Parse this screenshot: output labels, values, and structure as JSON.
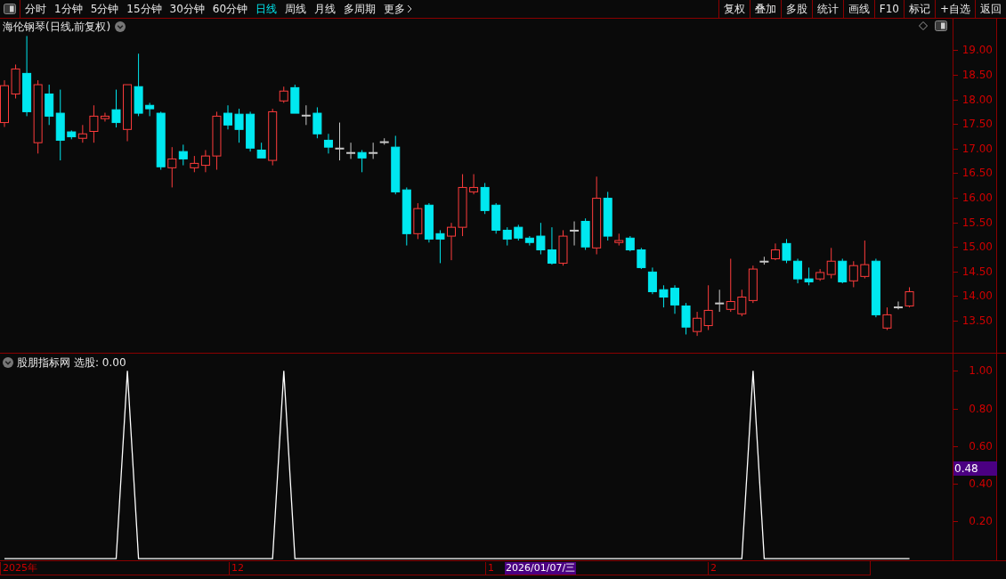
{
  "toolbar": {
    "periods": [
      {
        "label": "分时",
        "selected": false
      },
      {
        "label": "1分钟",
        "selected": false
      },
      {
        "label": "5分钟",
        "selected": false
      },
      {
        "label": "15分钟",
        "selected": false
      },
      {
        "label": "30分钟",
        "selected": false
      },
      {
        "label": "60分钟",
        "selected": false
      },
      {
        "label": "日线",
        "selected": true
      },
      {
        "label": "周线",
        "selected": false
      },
      {
        "label": "月线",
        "selected": false
      },
      {
        "label": "多周期",
        "selected": false
      },
      {
        "label": "更多",
        "selected": false
      }
    ],
    "buttons": [
      "复权",
      "叠加",
      "多股",
      "统计",
      "画线",
      "F10",
      "标记",
      "+自选",
      "返回"
    ]
  },
  "main_chart": {
    "title": "海伦钢琴(日线,前复权)",
    "chart_data": {
      "type": "candlestick",
      "ylim": [
        12.81,
        19.64
      ],
      "yticks": [
        {
          "value": 19,
          "label": "19.00"
        },
        {
          "value": 18.5,
          "label": "18.50"
        },
        {
          "value": 18,
          "label": "18.00"
        },
        {
          "value": 17.5,
          "label": "17.50"
        },
        {
          "value": 17,
          "label": "17.00"
        },
        {
          "value": 16.5,
          "label": "16.50"
        },
        {
          "value": 16,
          "label": "16.00"
        },
        {
          "value": 15.5,
          "label": "15.50"
        },
        {
          "value": 15,
          "label": "15.00"
        },
        {
          "value": 14.5,
          "label": "14.50"
        },
        {
          "value": 14,
          "label": "14.00"
        },
        {
          "value": 13.5,
          "label": "13.50"
        }
      ],
      "ohlc": [
        [
          17.51,
          18.37,
          17.42,
          18.26
        ],
        [
          18.09,
          18.69,
          18.0,
          18.6
        ],
        [
          18.51,
          19.27,
          17.64,
          17.73
        ],
        [
          17.1,
          18.37,
          16.88,
          18.28
        ],
        [
          18.09,
          18.28,
          17.46,
          17.64
        ],
        [
          17.7,
          18.18,
          16.74,
          17.15
        ],
        [
          17.32,
          17.35,
          17.17,
          17.22
        ],
        [
          17.19,
          17.46,
          17.1,
          17.28
        ],
        [
          17.33,
          17.86,
          17.1,
          17.64
        ],
        [
          17.59,
          17.71,
          17.53,
          17.64
        ],
        [
          17.77,
          18.18,
          17.41,
          17.51
        ],
        [
          17.37,
          18.28,
          17.13,
          18.28
        ],
        [
          18.24,
          18.91,
          17.64,
          17.7
        ],
        [
          17.86,
          17.91,
          17.64,
          17.79
        ],
        [
          17.7,
          17.73,
          16.55,
          16.61
        ],
        [
          16.59,
          17.01,
          16.19,
          16.77
        ],
        [
          16.92,
          17.06,
          16.64,
          16.77
        ],
        [
          16.59,
          16.83,
          16.5,
          16.68
        ],
        [
          16.64,
          16.95,
          16.5,
          16.83
        ],
        [
          16.83,
          17.73,
          16.55,
          17.64
        ],
        [
          17.7,
          17.86,
          17.37,
          17.46
        ],
        [
          17.68,
          17.79,
          17.1,
          17.37
        ],
        [
          17.68,
          17.73,
          16.92,
          16.99
        ],
        [
          16.95,
          17.1,
          16.79,
          16.79
        ],
        [
          16.74,
          17.79,
          16.64,
          17.73
        ],
        [
          17.95,
          18.24,
          17.91,
          18.15
        ],
        [
          18.22,
          18.28,
          17.7,
          17.7
        ],
        [
          17.66,
          17.86,
          17.46,
          17.66
        ],
        [
          17.7,
          17.82,
          17.19,
          17.28
        ],
        [
          17.15,
          17.28,
          16.88,
          17.01
        ],
        [
          16.99,
          17.51,
          16.74,
          16.99
        ],
        [
          16.9,
          17.1,
          16.77,
          16.9
        ],
        [
          16.9,
          16.95,
          16.5,
          16.79
        ],
        [
          16.9,
          17.1,
          16.77,
          16.9
        ],
        [
          17.12,
          17.19,
          17.06,
          17.12
        ],
        [
          17.01,
          17.24,
          16.05,
          16.1
        ],
        [
          16.14,
          16.19,
          15.01,
          15.25
        ],
        [
          15.25,
          15.87,
          15.14,
          15.76
        ],
        [
          15.83,
          15.87,
          15.07,
          15.14
        ],
        [
          15.25,
          15.32,
          14.65,
          15.14
        ],
        [
          15.2,
          15.47,
          14.71,
          15.38
        ],
        [
          15.38,
          16.46,
          15.2,
          16.19
        ],
        [
          16.1,
          16.46,
          16.05,
          16.19
        ],
        [
          16.19,
          16.28,
          15.65,
          15.72
        ],
        [
          15.83,
          15.87,
          15.25,
          15.32
        ],
        [
          15.32,
          15.38,
          15.01,
          15.14
        ],
        [
          15.38,
          15.43,
          15.11,
          15.16
        ],
        [
          15.16,
          15.2,
          15.01,
          15.07
        ],
        [
          15.2,
          15.47,
          14.83,
          14.92
        ],
        [
          14.92,
          15.38,
          14.62,
          14.65
        ],
        [
          14.65,
          15.32,
          14.6,
          15.2
        ],
        [
          15.32,
          15.5,
          15.01,
          15.32
        ],
        [
          15.5,
          15.56,
          14.92,
          14.98
        ],
        [
          14.96,
          16.41,
          14.83,
          15.97
        ],
        [
          15.97,
          16.1,
          15.11,
          15.2
        ],
        [
          15.07,
          15.25,
          15.01,
          15.11
        ],
        [
          15.16,
          15.2,
          14.89,
          14.92
        ],
        [
          14.92,
          14.96,
          14.53,
          14.56
        ],
        [
          14.47,
          14.56,
          14.02,
          14.07
        ],
        [
          14.11,
          14.2,
          13.75,
          13.96
        ],
        [
          14.14,
          14.2,
          13.62,
          13.8
        ],
        [
          13.78,
          13.84,
          13.2,
          13.35
        ],
        [
          13.26,
          13.66,
          13.17,
          13.53
        ],
        [
          13.38,
          14.2,
          13.29,
          13.69
        ],
        [
          13.84,
          14.11,
          13.66,
          13.84
        ],
        [
          13.71,
          14.74,
          13.66,
          13.87
        ],
        [
          13.62,
          14.11,
          13.57,
          13.96
        ],
        [
          13.89,
          14.6,
          13.84,
          14.53
        ],
        [
          14.69,
          14.78,
          14.62,
          14.69
        ],
        [
          14.74,
          15.05,
          14.71,
          14.92
        ],
        [
          15.05,
          15.14,
          14.65,
          14.71
        ],
        [
          14.69,
          14.74,
          14.24,
          14.33
        ],
        [
          14.33,
          14.56,
          14.2,
          14.27
        ],
        [
          14.33,
          14.53,
          14.29,
          14.46
        ],
        [
          14.42,
          14.96,
          14.34,
          14.69
        ],
        [
          14.69,
          14.74,
          14.24,
          14.27
        ],
        [
          14.29,
          14.69,
          14.16,
          14.6
        ],
        [
          14.38,
          15.11,
          14.34,
          14.62
        ],
        [
          14.69,
          14.74,
          13.55,
          13.6
        ],
        [
          13.33,
          13.75,
          13.29,
          13.6
        ],
        [
          13.76,
          13.87,
          13.71,
          13.76
        ],
        [
          13.78,
          14.16,
          13.75,
          14.07
        ]
      ]
    }
  },
  "indicator": {
    "title": "股朋指标网",
    "reading": ": 0.00",
    "cursor_value": "0.48",
    "chart_data": {
      "type": "line",
      "ylim": [
        -0.014,
        1.092
      ],
      "yticks": [
        {
          "value": 1.0,
          "label": "1.00"
        },
        {
          "value": 0.8,
          "label": "0.80"
        },
        {
          "value": 0.6,
          "label": "0.60"
        },
        {
          "value": 0.4,
          "label": "0.40"
        },
        {
          "value": 0.2,
          "label": "0.20"
        }
      ],
      "series": [
        {
          "name": "选股",
          "color": "#ffffff",
          "values": [
            0,
            0,
            0,
            0,
            0,
            0,
            0,
            0,
            0,
            0,
            0,
            1,
            0,
            0,
            0,
            0,
            0,
            0,
            0,
            0,
            0,
            0,
            0,
            0,
            0,
            1,
            0,
            0,
            0,
            0,
            0,
            0,
            0,
            0,
            0,
            0,
            0,
            0,
            0,
            0,
            0,
            0,
            0,
            0,
            0,
            0,
            0,
            0,
            0,
            0,
            0,
            0,
            0,
            0,
            0,
            0,
            0,
            0,
            0,
            0,
            0,
            0,
            0,
            0,
            0,
            0,
            0,
            1,
            0,
            0,
            0,
            0,
            0,
            0,
            0,
            0,
            0,
            0,
            0,
            0,
            0,
            0
          ]
        }
      ]
    }
  },
  "time_axis": {
    "labels": [
      "2025年",
      "12",
      "1",
      "2"
    ],
    "cursor_date": "2026/01/07/三"
  }
}
